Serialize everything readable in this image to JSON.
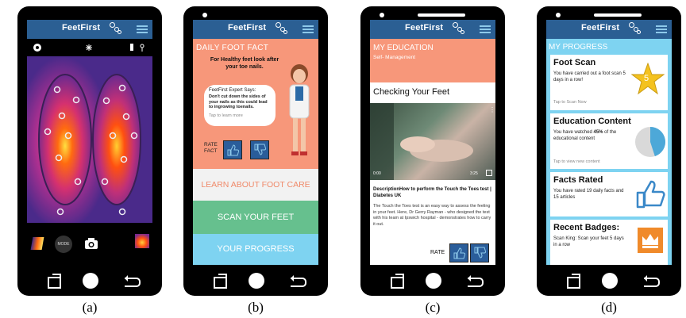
{
  "brand": "FeetFirst",
  "panel_a": {
    "caption": "(a)",
    "mode_label": "MODE"
  },
  "panel_b": {
    "caption": "(b)",
    "daily_fact_title": "DAILY FOOT FACT",
    "fact_headline": "For Healthy feet look after your toe nails.",
    "expert_heading": "FeetFirst Expert Says:",
    "expert_text": "Don't cut down the sides of your nails as this could lead to ingrowing toenails.",
    "tap_text": "Tap to learn more",
    "rate_label": "RATE FACT",
    "learn_button": "LEARN ABOUT FOOT CARE",
    "scan_button": "SCAN YOUR FEET",
    "progress_button": "YOUR PROGRESS",
    "colors": {
      "learn_bg": "#f2f2f2",
      "scan_bg": "#66c08e",
      "progress_bg": "#7ed3f1",
      "fact_bg": "#f7977a"
    }
  },
  "panel_c": {
    "caption": "(c)",
    "section_title": "MY EDUCATION",
    "section_subtitle": "Self- Management",
    "page_title": "Checking Your Feet",
    "video_time_start": "0:00",
    "video_time_end": "3:25",
    "description_title": "DescriptionHow to perform the Touch the Toes test | Diabetes UK",
    "description_body": "The Touch the Toes test is an easy way to assess the feeling in your feet. Here, Dr Gerry Rayman - who designed the test with his team at Ipswich hospital - demonstrates how to carry it out.",
    "rate_label": "RATE"
  },
  "panel_d": {
    "caption": "(d)",
    "section_title": "MY PROGRESS",
    "cards": [
      {
        "title": "Foot Scan",
        "text": "You have carried out a foot scan 5 days in a row!",
        "link": "Tap to Scan Now",
        "badge_value": "5"
      },
      {
        "title": "Education Content",
        "text_pre": "You have watched ",
        "text_bold": "45%",
        "text_post": " of the educational content",
        "link": "Tap to view new content",
        "watched_fraction": 0.45
      },
      {
        "title": "Facts Rated",
        "text": "You have rated 19 daily facts and 15 articles"
      },
      {
        "title": "Recent Badges:",
        "text": "Scan King: Scan your feet 5 days in a row"
      }
    ]
  }
}
